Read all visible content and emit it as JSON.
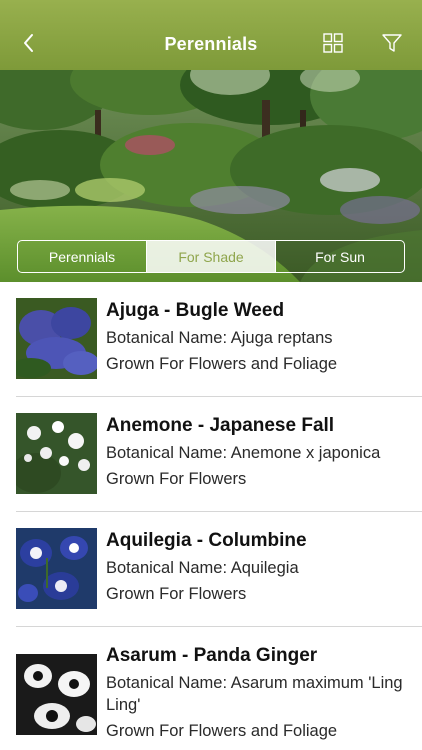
{
  "nav": {
    "title": "Perennials",
    "back_icon": "chevron-left-icon",
    "grid_icon": "grid-icon",
    "filter_icon": "filter-icon",
    "bar_color": "#8aa445"
  },
  "segments": [
    {
      "label": "Perennials",
      "active": false
    },
    {
      "label": "For Shade",
      "active": true
    },
    {
      "label": "For Sun",
      "active": false
    }
  ],
  "plants": [
    {
      "title": "Ajuga - Bugle Weed",
      "botanical": "Botanical Name: Ajuga reptans",
      "grown": "Grown For Flowers and Foliage"
    },
    {
      "title": "Anemone - Japanese Fall",
      "botanical": "Botanical Name: Anemone x japonica",
      "grown": "Grown For Flowers"
    },
    {
      "title": "Aquilegia - Columbine",
      "botanical": "Botanical Name: Aquilegia",
      "grown": "Grown For Flowers"
    },
    {
      "title": "Asarum - Panda Ginger",
      "botanical": "Botanical Name: Asarum maximum 'Ling Ling'",
      "grown": "Grown For Flowers and Foliage"
    }
  ]
}
